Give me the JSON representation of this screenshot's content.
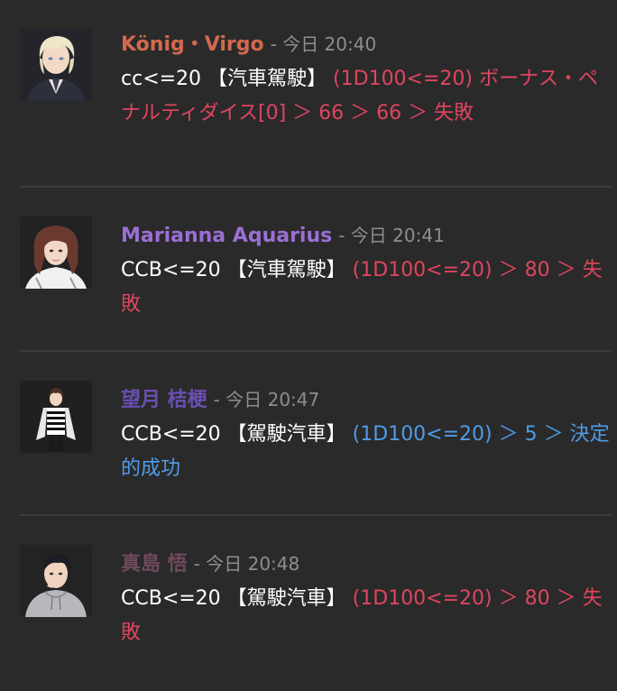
{
  "messages": [
    {
      "author": "König・Virgo",
      "author_color": "#d2694e",
      "timestamp": "- 今日 20:40",
      "command": "cc<=20 【汽車駕駛】 ",
      "result": "(1D100<=20) ボーナス・ペナルティダイス[0] ＞ 66 ＞ 66 ＞ 失敗",
      "result_color": "#e0455f",
      "avatar_icon": "blond-haired-man-avatar-icon"
    },
    {
      "author": "Marianna Aquarius",
      "author_color": "#9b6fd6",
      "timestamp": "- 今日 20:41",
      "command": "CCB<=20 【汽車駕駛】 ",
      "result": "(1D100<=20) ＞ 80 ＞ 失敗",
      "result_color": "#e0455f",
      "avatar_icon": "curly-haired-woman-avatar-icon"
    },
    {
      "author": "望月 桔梗",
      "author_color": "#6a4fb0",
      "timestamp": "- 今日 20:47",
      "command": "CCB<=20 【駕駛汽車】 ",
      "result": "(1D100<=20) ＞ 5 ＞ 決定的成功",
      "result_color": "#4f9be8",
      "avatar_icon": "striped-shirt-man-avatar-icon"
    },
    {
      "author": "真島 悟",
      "author_color": "#6e4a5e",
      "timestamp": "- 今日 20:48",
      "command": "CCB<=20 【駕駛汽車】 ",
      "result": "(1D100<=20) ＞ 80 ＞ 失敗",
      "result_color": "#e0455f",
      "avatar_icon": "hoodie-man-avatar-icon"
    }
  ]
}
